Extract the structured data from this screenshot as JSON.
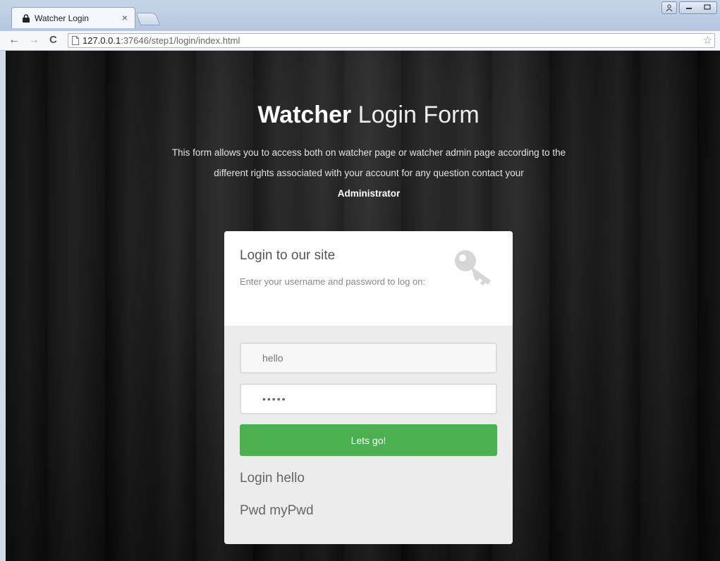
{
  "browser": {
    "tab_title": "Watcher Login",
    "tab_close": "×",
    "url_host": "127.0.0.1",
    "url_rest": ":37646/step1/login/index.html",
    "nav": {
      "back": "←",
      "forward": "→",
      "reload": "C"
    },
    "star": "☆"
  },
  "page": {
    "heading_bold": "Watcher",
    "heading_light": " Login Form",
    "description": "This form allows you to access both on watcher page or watcher admin page according to the different rights associated with your account for any question contact your",
    "description_bold": "Administrator"
  },
  "card": {
    "title": "Login to our site",
    "subtitle": "Enter your username and password to log on:",
    "username_value": "hello",
    "password_value": "•••••",
    "submit_label": "Lets go!",
    "login_info": "Login hello",
    "pwd_info": "Pwd myPwd"
  },
  "colors": {
    "accent": "#4caf50",
    "card_bg": "#ececec",
    "background": "#1b1b1b"
  },
  "icons": {
    "tab": "lock-icon",
    "omnibox": "page-icon",
    "card": "key-icon"
  }
}
